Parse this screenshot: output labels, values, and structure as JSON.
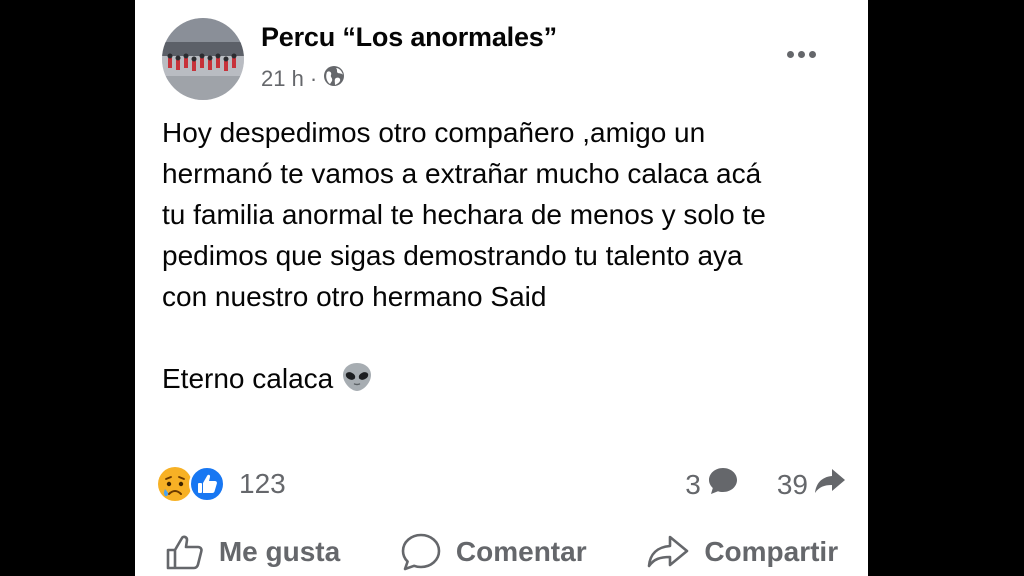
{
  "post": {
    "author": "Percu “Los anormales”",
    "time": "21 h",
    "separator": "·",
    "privacy_icon": "globe-icon",
    "more_icon": "more-options-icon",
    "body_lines": [
      "Hoy despedimos otro compañero ,amigo un",
      "hermanó te vamos a extrañar mucho calaca acá",
      "tu familia anormal te hechara de menos y solo te",
      "pedimos que sigas demostrando tu talento aya",
      "con nuestro otro hermano Said"
    ],
    "closing": "Eterno calaca",
    "closing_emoji": "alien-emoji"
  },
  "stats": {
    "reaction_icons": [
      "sad-reaction-icon",
      "like-reaction-icon"
    ],
    "reactions_count": "123",
    "comments_count": "3",
    "shares_count": "39"
  },
  "actions": {
    "like": "Me gusta",
    "comment": "Comentar",
    "share": "Compartir"
  },
  "colors": {
    "like_blue": "#1877f2",
    "secondary_text": "#65676b",
    "primary_text": "#050505"
  }
}
